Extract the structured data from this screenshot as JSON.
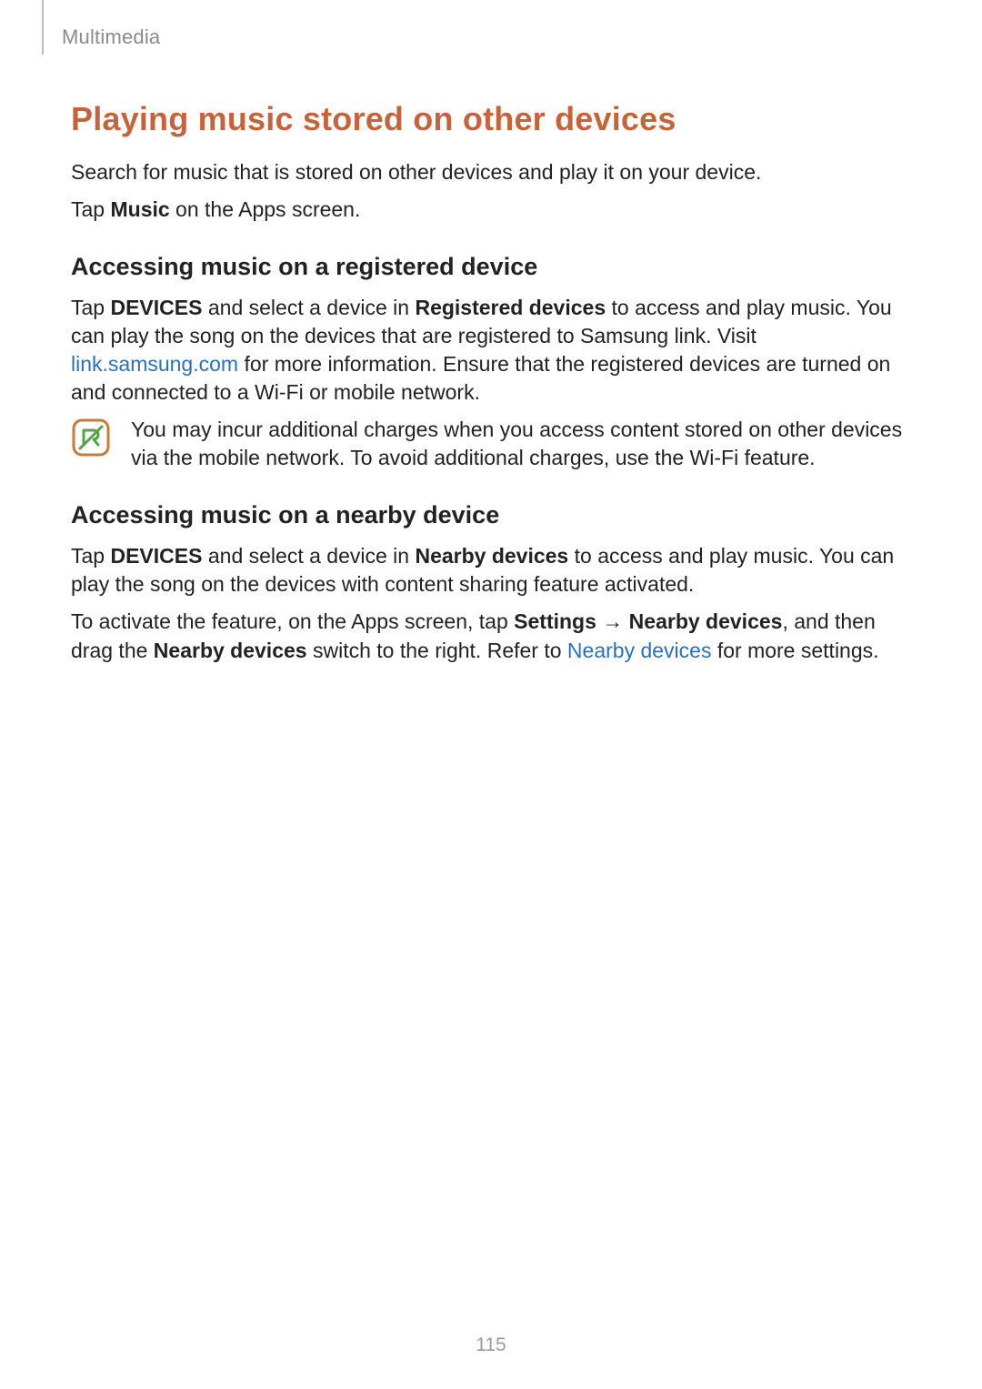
{
  "header": {
    "section": "Multimedia"
  },
  "h1": "Playing music stored on other devices",
  "intro1": "Search for music that is stored on other devices and play it on your device.",
  "intro2_pre": "Tap ",
  "intro2_bold": "Music",
  "intro2_post": " on the Apps screen.",
  "sec1": {
    "heading": "Accessing music on a registered device",
    "p1_pre": "Tap ",
    "p1_b1": "DEVICES",
    "p1_mid1": " and select a device in ",
    "p1_b2": "Registered devices",
    "p1_mid2": " to access and play music. You can play the song on the devices that are registered to Samsung link. Visit ",
    "p1_link": "link.samsung.com",
    "p1_post": " for more information. Ensure that the registered devices are turned on and connected to a Wi-Fi or mobile network.",
    "note": "You may incur additional charges when you access content stored on other devices via the mobile network. To avoid additional charges, use the Wi-Fi feature."
  },
  "sec2": {
    "heading": "Accessing music on a nearby device",
    "p1_pre": "Tap ",
    "p1_b1": "DEVICES",
    "p1_mid1": " and select a device in ",
    "p1_b2": "Nearby devices",
    "p1_post": " to access and play music. You can play the song on the devices with content sharing feature activated.",
    "p2_pre": "To activate the feature, on the Apps screen, tap ",
    "p2_b1": "Settings",
    "p2_arrow": " → ",
    "p2_b2": "Nearby devices",
    "p2_mid": ", and then drag the ",
    "p2_b3": "Nearby devices",
    "p2_mid2": " switch to the right. Refer to ",
    "p2_link": "Nearby devices",
    "p2_post": " for more settings."
  },
  "pageNumber": "115"
}
